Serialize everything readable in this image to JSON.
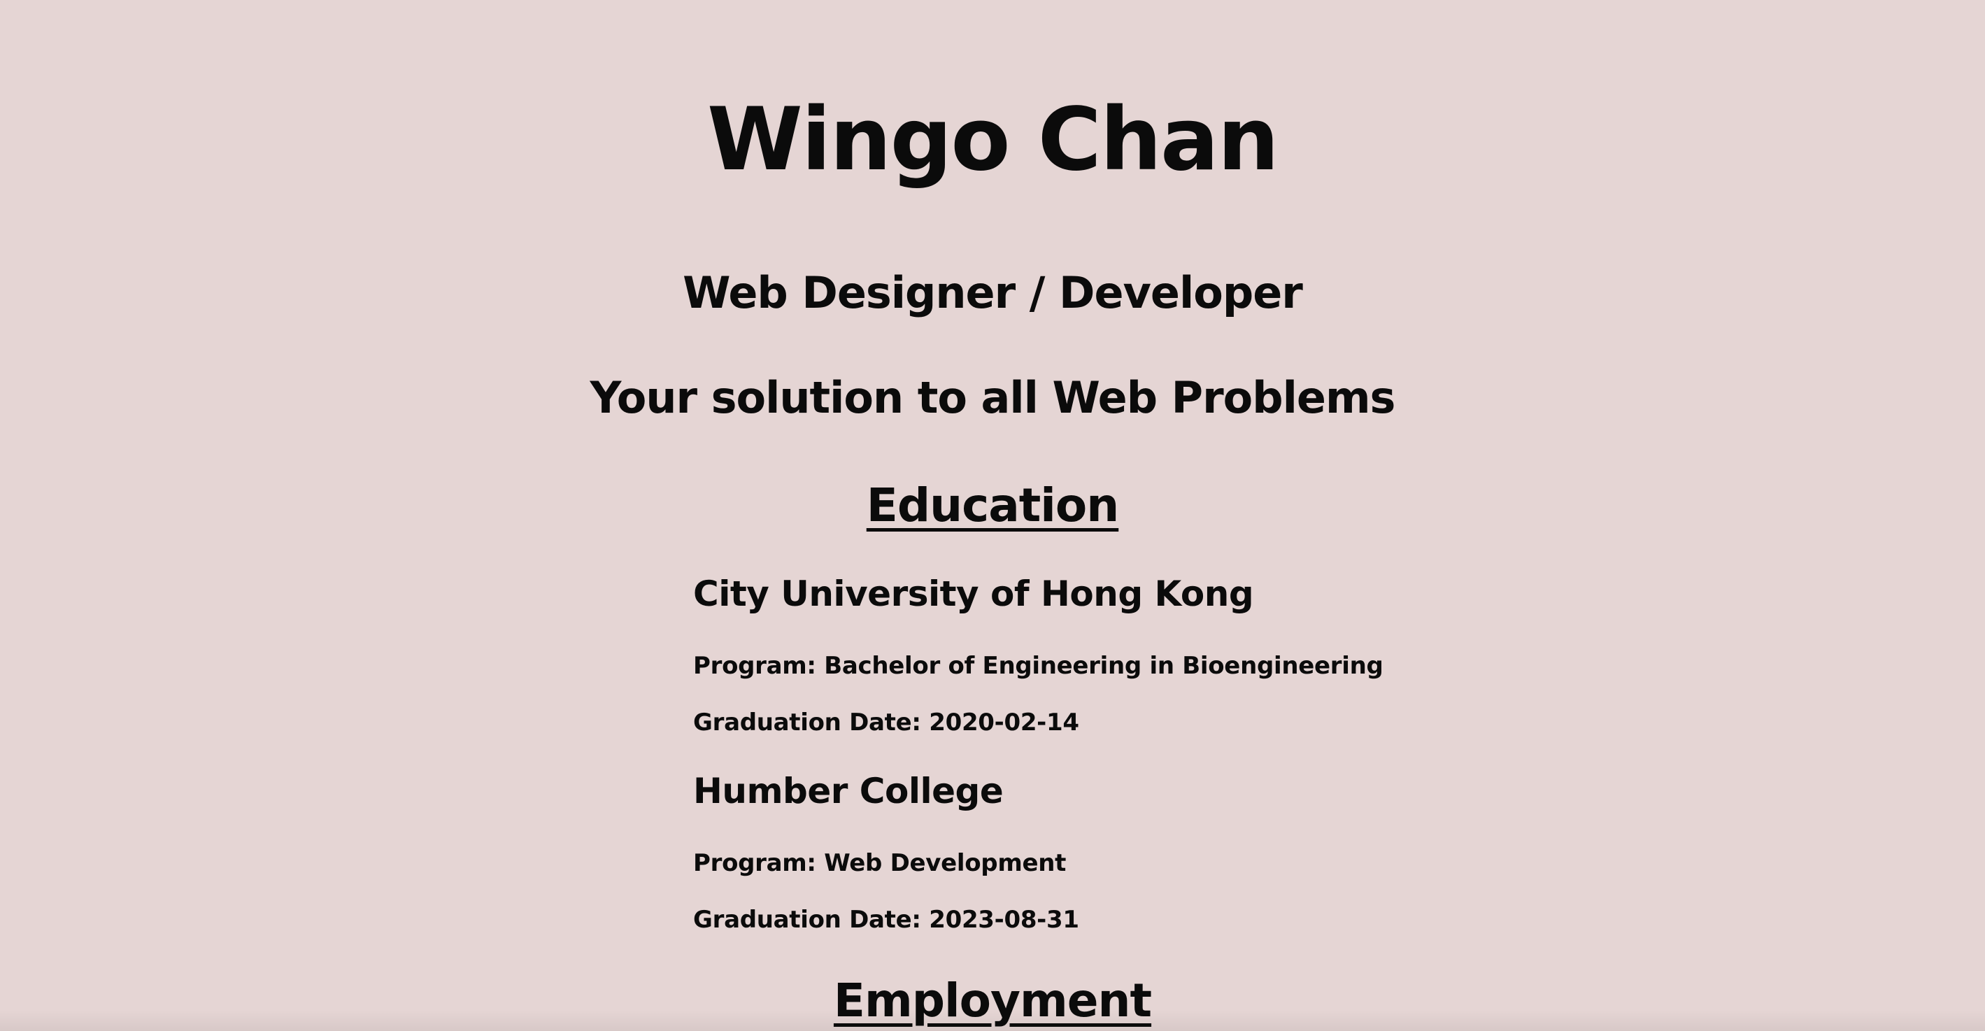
{
  "header": {
    "name": "Wingo Chan",
    "role": "Web Designer / Developer",
    "tagline": "Your solution to all Web Problems"
  },
  "education": {
    "heading": "Education",
    "entries": [
      {
        "school": "City University of Hong Kong",
        "program": "Program: Bachelor of Engineering in Bioengineering",
        "graduation": "Graduation Date: 2020-02-14"
      },
      {
        "school": "Humber College",
        "program": "Program: Web Development",
        "graduation": "Graduation Date: 2023-08-31"
      }
    ]
  },
  "employment": {
    "heading": "Employment"
  },
  "colors": {
    "background": "#e5d5d4",
    "text": "#0b0b0b"
  }
}
